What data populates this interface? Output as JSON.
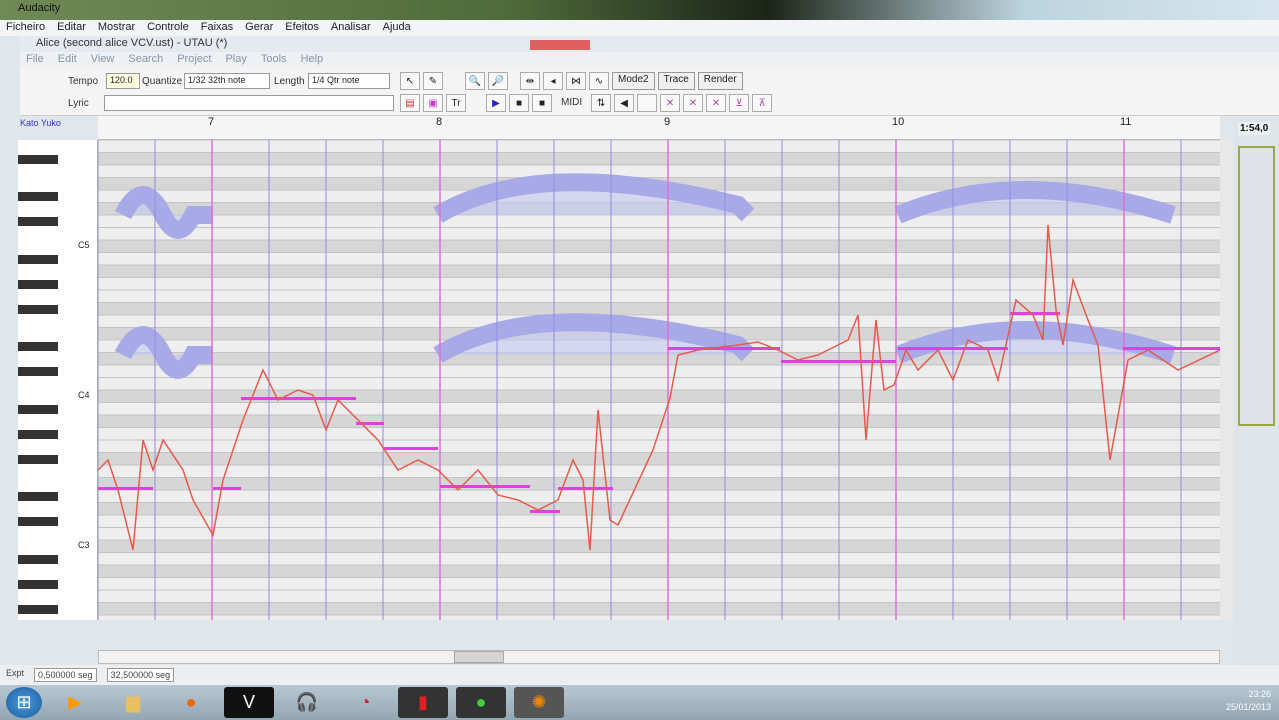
{
  "window": {
    "title": "Audacity"
  },
  "menu": [
    "Ficheiro",
    "Editar",
    "Mostrar",
    "Controle",
    "Faixas",
    "Gerar",
    "Efeitos",
    "Analisar",
    "Ajuda"
  ],
  "utau": {
    "title": "Alice (second alice VCV.ust) - UTAU (*)",
    "menu": [
      "File",
      "Edit",
      "View",
      "Search",
      "Project",
      "Play",
      "Tools",
      "Help"
    ],
    "tempo_label": "Tempo",
    "tempo": "120.0",
    "quantize_label": "Quantize",
    "quantize": "1/32 32th note",
    "length_label": "Length",
    "length": "1/4 Qtr note",
    "lyric_label": "Lyric",
    "lyric": "",
    "mode_btn": "Mode2",
    "trace_btn": "Trace",
    "render_btn": "Render",
    "midi_label": "MIDI",
    "track_label": "Kato Yuko",
    "bars": [
      "7",
      "8",
      "9",
      "10",
      "11"
    ],
    "octave_labels": [
      "C5",
      "C4",
      "C3"
    ],
    "time_readout": "1:54,0"
  },
  "status": {
    "rate_label": "Expt",
    "selection_start": "0,500000 seg",
    "selection_end": "32,500000 seg"
  },
  "taskbar": {
    "clock": "23:26",
    "date": "25/01/2013"
  },
  "colors": {
    "note": "#e040e0",
    "pitch": "#e85a4a",
    "beat": "#8c8ce0",
    "bar": "#e070d0"
  }
}
